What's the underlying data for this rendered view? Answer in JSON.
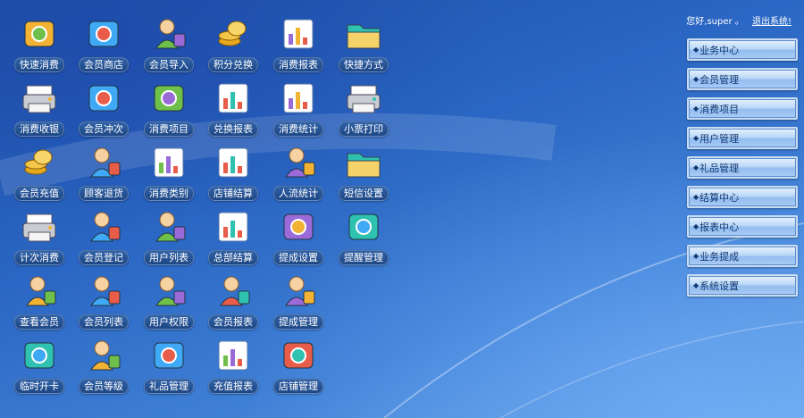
{
  "header": {
    "greeting": "您好,super 。",
    "logout_label": "退出系统!"
  },
  "tiles": [
    {
      "label": "快速消费",
      "icon": "card-payment-icon"
    },
    {
      "label": "会员商店",
      "icon": "globe-arrow-icon"
    },
    {
      "label": "会员导入",
      "icon": "user-lock-icon"
    },
    {
      "label": "积分兑换",
      "icon": "money-bag-icon"
    },
    {
      "label": "消费报表",
      "icon": "bar-report-icon"
    },
    {
      "label": "快捷方式",
      "icon": "folder-icon"
    },
    {
      "label": "消费收银",
      "icon": "cash-register-icon"
    },
    {
      "label": "会员冲次",
      "icon": "calculator-icon"
    },
    {
      "label": "消费项目",
      "icon": "shopping-basket-icon"
    },
    {
      "label": "兑换报表",
      "icon": "pie-chart-icon"
    },
    {
      "label": "消费统计",
      "icon": "bar-stats-icon"
    },
    {
      "label": "小票打印",
      "icon": "printer-icon"
    },
    {
      "label": "会员充值",
      "icon": "coins-icon"
    },
    {
      "label": "顾客退货",
      "icon": "user-return-icon"
    },
    {
      "label": "消费类别",
      "icon": "org-chart-icon"
    },
    {
      "label": "店铺结算",
      "icon": "pie-settle-icon"
    },
    {
      "label": "人流统计",
      "icon": "people-icon"
    },
    {
      "label": "短信设置",
      "icon": "envelope-gear-icon"
    },
    {
      "label": "计次消费",
      "icon": "count-register-icon"
    },
    {
      "label": "会员登记",
      "icon": "user-register-icon"
    },
    {
      "label": "用户列表",
      "icon": "users-list-icon"
    },
    {
      "label": "总部结算",
      "icon": "hq-settle-icon"
    },
    {
      "label": "提成设置",
      "icon": "database-icon"
    },
    {
      "label": "提醒管理",
      "icon": "monitor-clock-icon"
    },
    {
      "label": "查看会员",
      "icon": "user-view-icon"
    },
    {
      "label": "会员列表",
      "icon": "user-list-icon"
    },
    {
      "label": "用户权限",
      "icon": "user-permission-icon"
    },
    {
      "label": "会员报表",
      "icon": "user-report-icon"
    },
    {
      "label": "提成管理",
      "icon": "person-gold-icon"
    },
    {
      "label": "临时开卡",
      "icon": "temp-card-icon"
    },
    {
      "label": "会员等级",
      "icon": "user-level-icon"
    },
    {
      "label": "礼品管理",
      "icon": "gift-icon"
    },
    {
      "label": "充值报表",
      "icon": "recharge-report-icon"
    },
    {
      "label": "店铺管理",
      "icon": "store-icon"
    }
  ],
  "menu": {
    "bullet": "◆",
    "items": [
      {
        "label": "业务中心"
      },
      {
        "label": "会员管理"
      },
      {
        "label": "消费项目"
      },
      {
        "label": "用户管理"
      },
      {
        "label": "礼品管理"
      },
      {
        "label": "结算中心"
      },
      {
        "label": "报表中心"
      },
      {
        "label": "业务提成"
      },
      {
        "label": "系统设置"
      }
    ]
  }
}
